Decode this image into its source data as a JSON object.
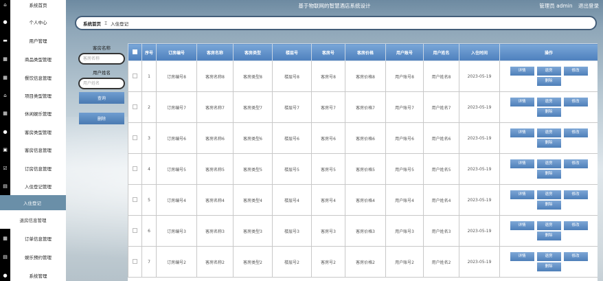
{
  "header": {
    "title": "基于物联网的智慧酒店系统设计",
    "admin_text": "管理员 admin",
    "logout": "退出登录"
  },
  "breadcrumb": {
    "home": "系统首页",
    "sep": "Ξ",
    "current": "入住登记"
  },
  "sidebar": {
    "items": [
      {
        "label": "系统首页",
        "icon": "home-icon",
        "glyph": "⌂"
      },
      {
        "label": "个人中心",
        "icon": "user-icon",
        "glyph": "●"
      },
      {
        "label": "用户管理",
        "icon": "message-icon",
        "glyph": "▬"
      },
      {
        "label": "商品类型管理",
        "icon": "grid-icon",
        "glyph": "▦"
      },
      {
        "label": "餐饮信息管理",
        "icon": "grid-icon",
        "glyph": "▦"
      },
      {
        "label": "项目类型管理",
        "icon": "home-icon",
        "glyph": "⌂"
      },
      {
        "label": "休闲娱乐管理",
        "icon": "grid-icon",
        "glyph": "▦"
      },
      {
        "label": "客房类型管理",
        "icon": "location-icon",
        "glyph": "●"
      },
      {
        "label": "客房信息管理",
        "icon": "calendar-icon",
        "glyph": "▣"
      },
      {
        "label": "订房信息管理",
        "icon": "check-box-icon",
        "glyph": "☑"
      },
      {
        "label": "入住登记管理",
        "icon": "briefcase-icon",
        "glyph": "▤"
      }
    ],
    "sub_items": [
      {
        "label": "入住登记"
      },
      {
        "label": "退房信息管理"
      }
    ],
    "bottom_items": [
      {
        "label": "订单信息管理",
        "icon": "grid-icon",
        "glyph": "▦"
      },
      {
        "label": "娱乐预约管理",
        "icon": "document-icon",
        "glyph": "▤"
      },
      {
        "label": "系统管理",
        "icon": "user-icon",
        "glyph": "●"
      }
    ]
  },
  "search": {
    "room_name_label": "客房名称",
    "room_name_placeholder": "客房名称",
    "user_name_label": "用户姓名",
    "user_name_placeholder": "用户姓名",
    "query_button": "查询",
    "delete_button": "删除"
  },
  "table": {
    "headers": [
      "序号",
      "订房编号",
      "客房名称",
      "客房类型",
      "楼层号",
      "客房号",
      "客房价格",
      "用户账号",
      "用户姓名",
      "入住时间",
      "操作"
    ],
    "rows": [
      [
        "1",
        "订房编号8",
        "客房名称8",
        "客房类型8",
        "楼层号8",
        "客房号8",
        "客房价格8",
        "用户账号8",
        "用户姓名8",
        "2023-05-19"
      ],
      [
        "2",
        "订房编号7",
        "客房名称7",
        "客房类型7",
        "楼层号7",
        "客房号7",
        "客房价格7",
        "用户账号7",
        "用户姓名7",
        "2023-05-19"
      ],
      [
        "3",
        "订房编号6",
        "客房名称6",
        "客房类型6",
        "楼层号6",
        "客房号6",
        "客房价格6",
        "用户账号6",
        "用户姓名6",
        "2023-05-19"
      ],
      [
        "4",
        "订房编号5",
        "客房名称5",
        "客房类型5",
        "楼层号5",
        "客房号5",
        "客房价格5",
        "用户账号5",
        "用户姓名5",
        "2023-05-19"
      ],
      [
        "5",
        "订房编号4",
        "客房名称4",
        "客房类型4",
        "楼层号4",
        "客房号4",
        "客房价格4",
        "用户账号4",
        "用户姓名4",
        "2023-05-19"
      ],
      [
        "6",
        "订房编号3",
        "客房名称3",
        "客房类型3",
        "楼层号3",
        "客房号3",
        "客房价格3",
        "用户账号3",
        "用户姓名3",
        "2023-05-19"
      ],
      [
        "7",
        "订房编号2",
        "客房名称2",
        "客房类型2",
        "楼层号2",
        "客房号2",
        "客房价格2",
        "用户账号2",
        "用户姓名2",
        "2023-05-19"
      ]
    ],
    "actions": {
      "detail": "详情",
      "checkout": "退房",
      "edit": "修改",
      "delete": "删除"
    }
  }
}
